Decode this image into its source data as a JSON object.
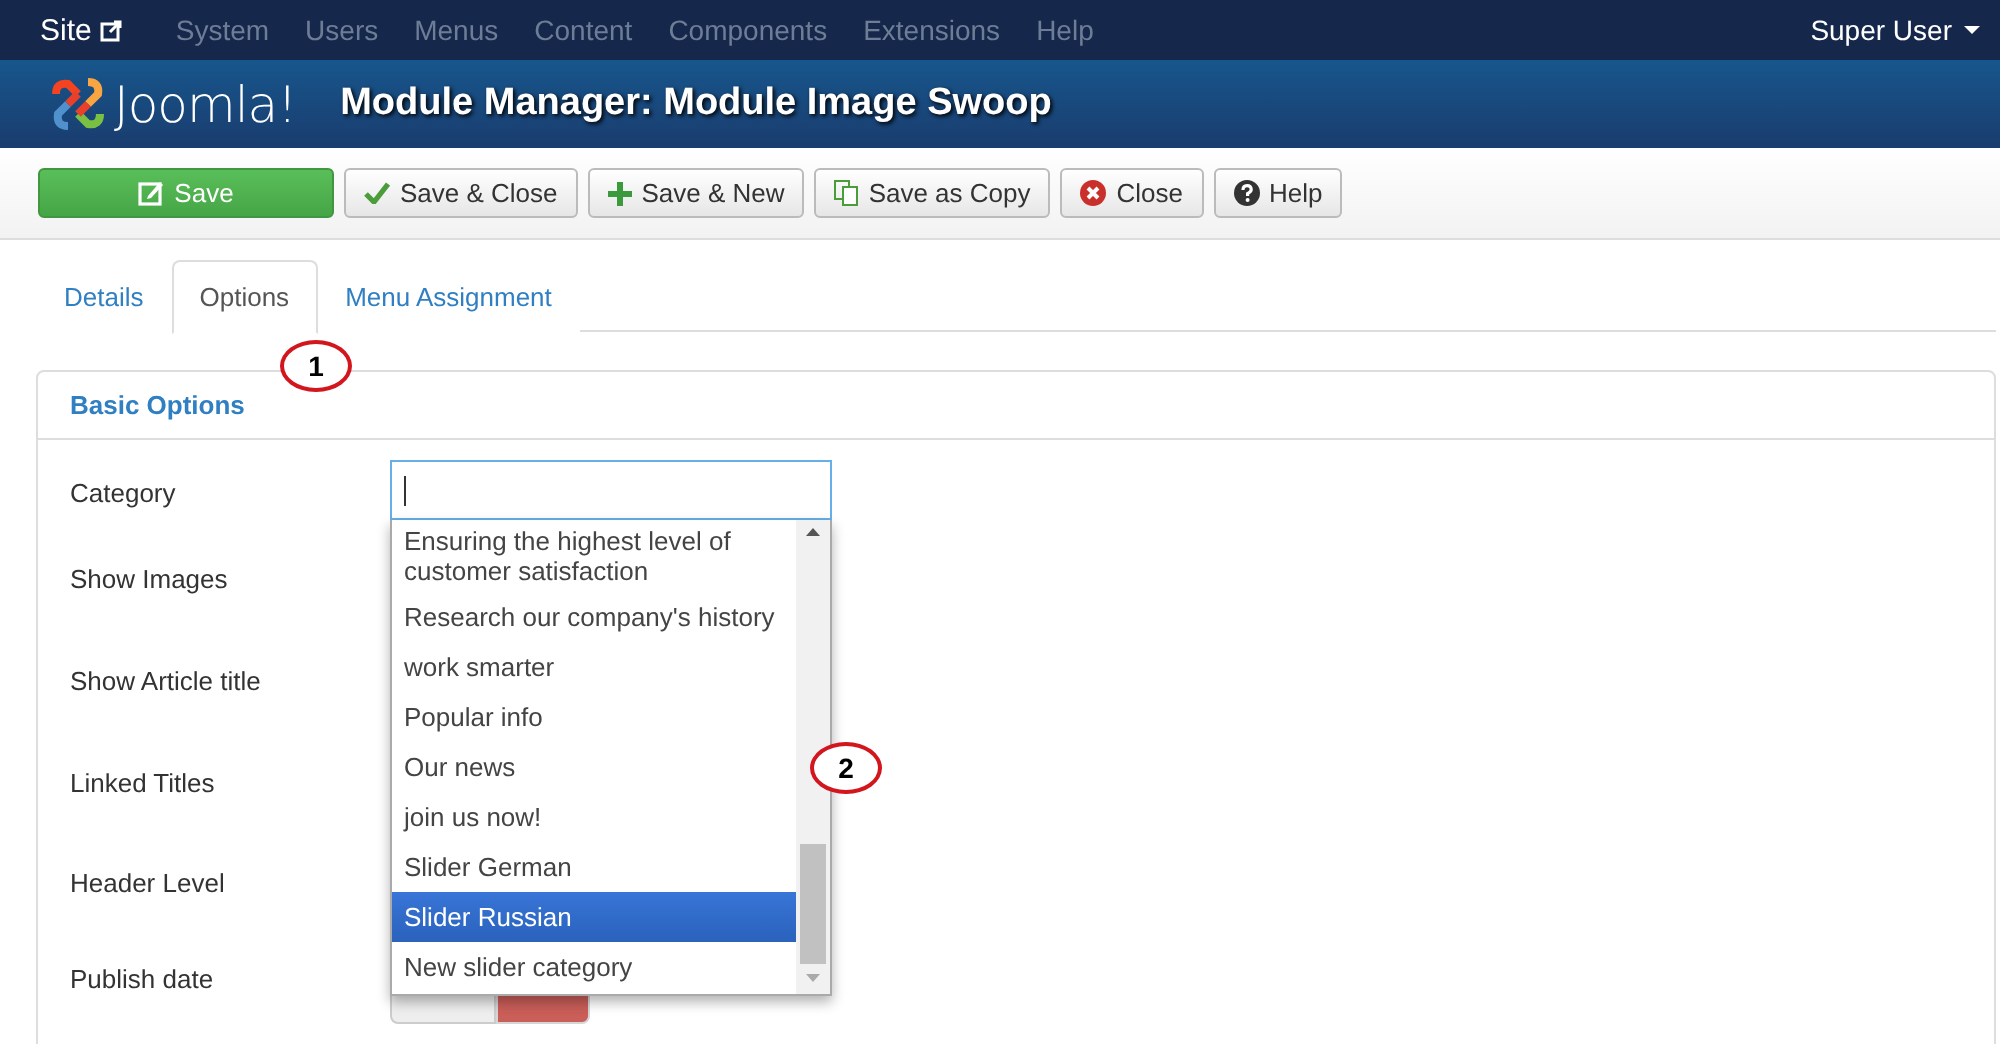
{
  "top_menu": {
    "site": "Site",
    "items": [
      "System",
      "Users",
      "Menus",
      "Content",
      "Components",
      "Extensions",
      "Help"
    ],
    "user": "Super User"
  },
  "header": {
    "logo": "Joomla!",
    "title": "Module Manager: Module Image Swoop"
  },
  "toolbar": [
    {
      "kind": "save",
      "label": "Save"
    },
    {
      "kind": "check",
      "label": "Save & Close"
    },
    {
      "kind": "plus",
      "label": "Save & New"
    },
    {
      "kind": "copy",
      "label": "Save as Copy"
    },
    {
      "kind": "close",
      "label": "Close"
    },
    {
      "kind": "help",
      "label": "Help"
    }
  ],
  "tabs": [
    {
      "label": "Details",
      "selected": false
    },
    {
      "label": "Options",
      "selected": true
    },
    {
      "label": "Menu Assignment",
      "selected": false
    }
  ],
  "panel": {
    "title": "Basic Options",
    "fields": [
      {
        "label": "Category"
      },
      {
        "label": "Show Images"
      },
      {
        "label": "Show Article title"
      },
      {
        "label": "Linked Titles"
      },
      {
        "label": "Header Level"
      },
      {
        "label": "Publish date"
      }
    ],
    "publish_toggle": [
      {
        "selected": false
      },
      {
        "selected": true
      }
    ],
    "category_dropdown": {
      "options": [
        {
          "label": "Ensuring the highest level of customer satisfaction",
          "selected": false
        },
        {
          "label": "Research our company's history",
          "selected": false
        },
        {
          "label": "work smarter",
          "selected": false
        },
        {
          "label": "Popular info",
          "selected": false
        },
        {
          "label": "Our news",
          "selected": false
        },
        {
          "label": "join us now!",
          "selected": false
        },
        {
          "label": "Slider German",
          "selected": false
        },
        {
          "label": "Slider Russian",
          "selected": true
        },
        {
          "label": "New slider category",
          "selected": false
        }
      ]
    }
  },
  "annotations": [
    "1",
    "2"
  ]
}
